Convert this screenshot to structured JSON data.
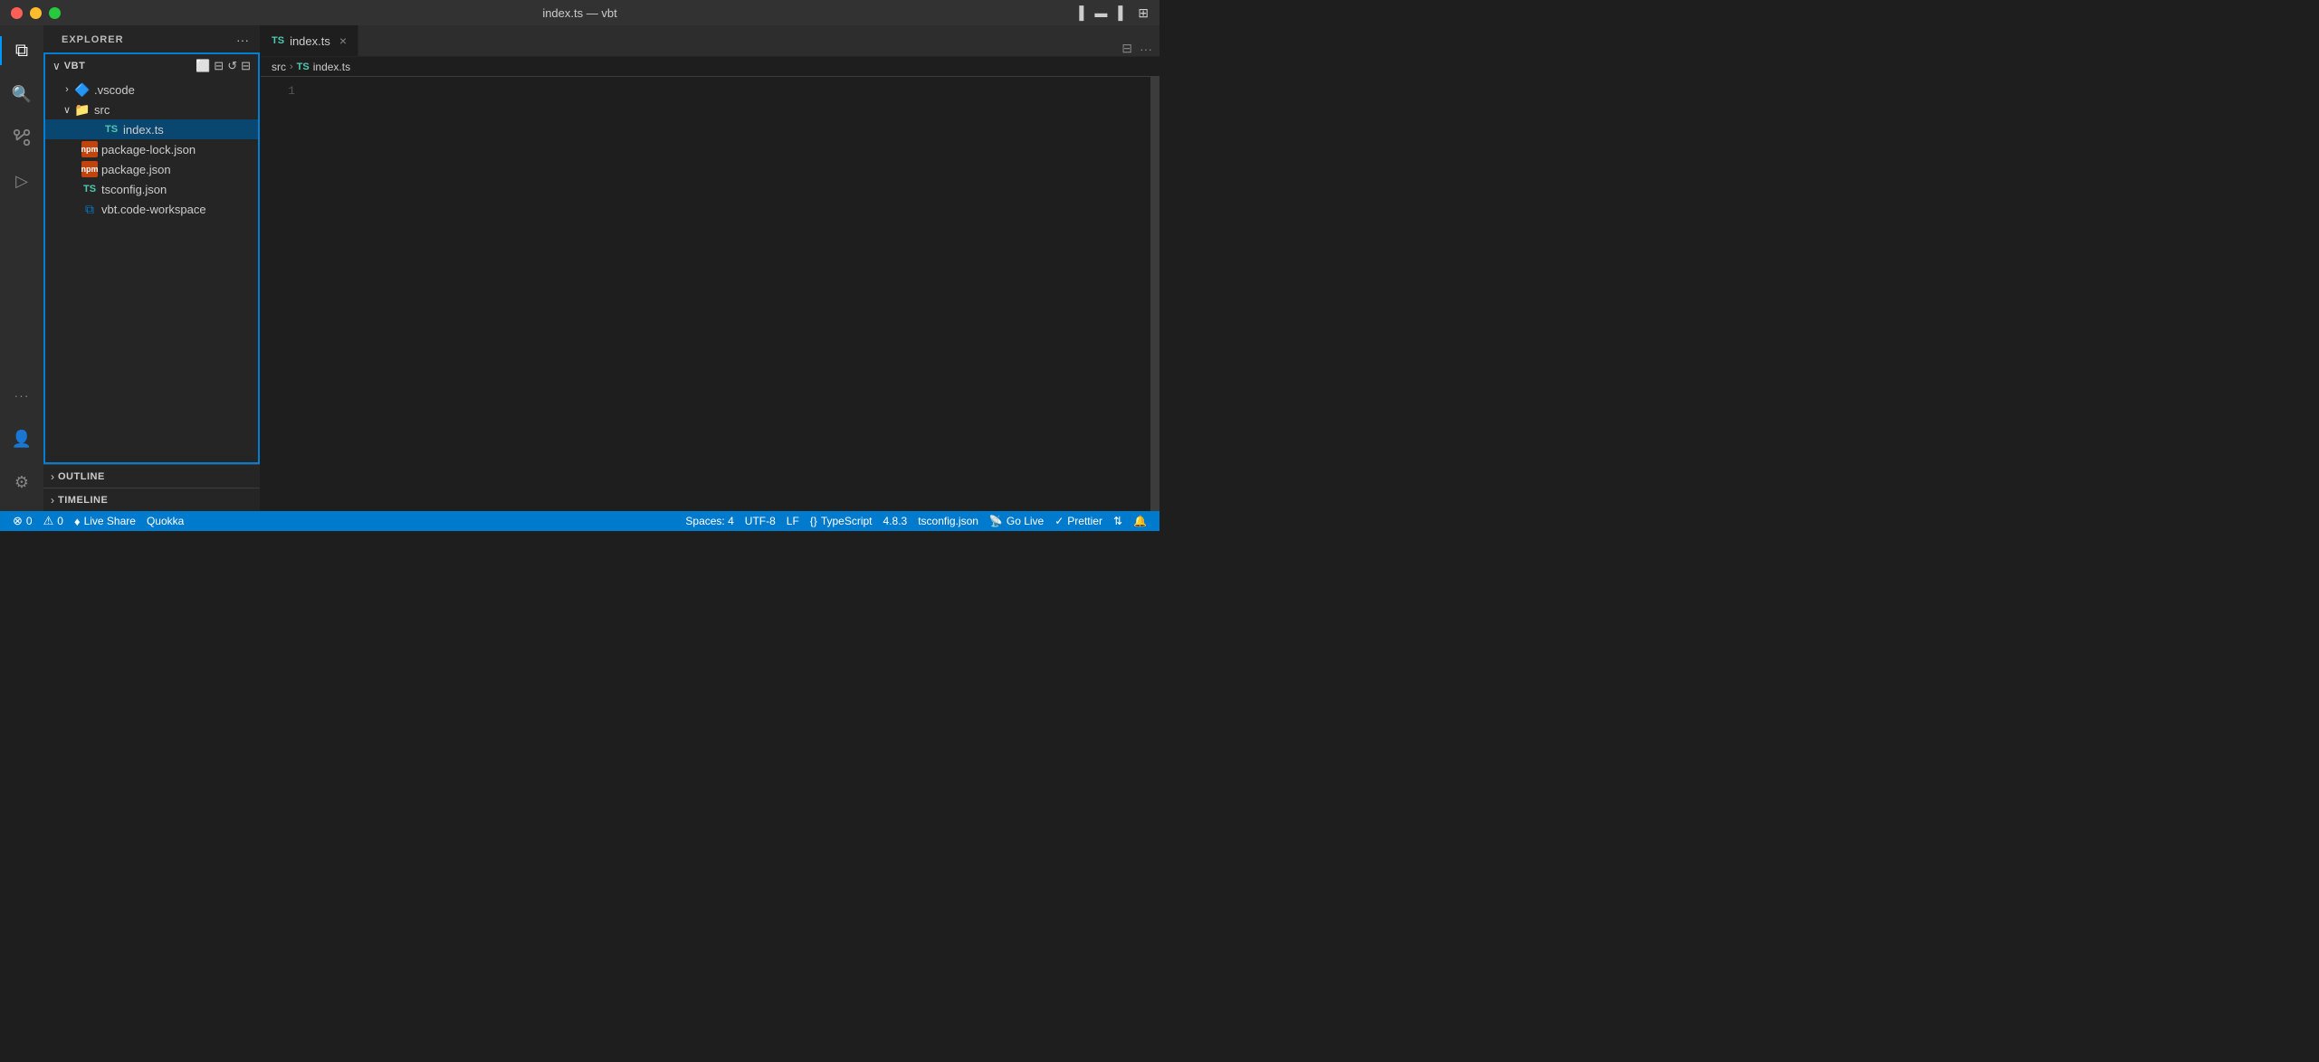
{
  "titlebar": {
    "title": "index.ts — vbt",
    "buttons": {
      "close": "close",
      "minimize": "minimize",
      "maximize": "maximize"
    },
    "right_icons": [
      "panel-left",
      "panel-bottom",
      "panel-right",
      "layout"
    ]
  },
  "activity_bar": {
    "items": [
      {
        "name": "explorer",
        "icon": "⧉",
        "active": true
      },
      {
        "name": "search",
        "icon": "🔍",
        "active": false
      },
      {
        "name": "source-control",
        "icon": "⎇",
        "active": false
      },
      {
        "name": "run-debug",
        "icon": "▷",
        "active": false
      },
      {
        "name": "more",
        "icon": "···",
        "active": false
      }
    ],
    "bottom_items": [
      {
        "name": "account",
        "icon": "👤"
      },
      {
        "name": "settings",
        "icon": "⚙"
      }
    ]
  },
  "sidebar": {
    "title": "EXPLORER",
    "more_icon": "···",
    "project": {
      "name": "VBT",
      "expanded": true
    },
    "toolbar": {
      "new_file": "new-file",
      "new_folder": "new-folder",
      "refresh": "refresh",
      "collapse": "collapse"
    },
    "tree": [
      {
        "type": "folder",
        "name": ".vscode",
        "level": 1,
        "expanded": false,
        "icon_color": "#007acc"
      },
      {
        "type": "folder",
        "name": "src",
        "level": 1,
        "expanded": true,
        "icon_color": "#4db6ac"
      },
      {
        "type": "file",
        "name": "index.ts",
        "level": 2,
        "icon": "TS",
        "icon_color": "#4ec9b0",
        "selected": true
      },
      {
        "type": "file",
        "name": "package-lock.json",
        "level": 1,
        "icon": "json",
        "icon_color": "#e2a644"
      },
      {
        "type": "file",
        "name": "package.json",
        "level": 1,
        "icon": "json",
        "icon_color": "#e2a644"
      },
      {
        "type": "file",
        "name": "tsconfig.json",
        "level": 1,
        "icon": "tsconfig",
        "icon_color": "#4ec9b0"
      },
      {
        "type": "file",
        "name": "vbt.code-workspace",
        "level": 1,
        "icon": "vscode",
        "icon_color": "#007acc"
      }
    ],
    "outline": {
      "title": "OUTLINE"
    },
    "timeline": {
      "title": "TIMELINE"
    }
  },
  "editor": {
    "tabs": [
      {
        "label": "index.ts",
        "ts_icon": "TS",
        "active": true,
        "modified": false
      }
    ],
    "breadcrumb": [
      "src",
      "index.ts"
    ],
    "line_count": 1,
    "content": ""
  },
  "status_bar": {
    "left": [
      {
        "icon": "⊗",
        "text": "0",
        "name": "errors"
      },
      {
        "icon": "⚠",
        "text": "0",
        "name": "warnings"
      },
      {
        "icon": "♦",
        "text": "Live Share",
        "name": "live-share"
      },
      {
        "text": "Quokka",
        "name": "quokka"
      }
    ],
    "right": [
      {
        "text": "Spaces: 4",
        "name": "spaces"
      },
      {
        "text": "UTF-8",
        "name": "encoding"
      },
      {
        "text": "LF",
        "name": "line-endings"
      },
      {
        "icon": "{}",
        "text": "TypeScript",
        "name": "language"
      },
      {
        "text": "4.8.3",
        "name": "ts-version"
      },
      {
        "text": "tsconfig.json",
        "name": "tsconfig"
      },
      {
        "icon": "📡",
        "text": "Go Live",
        "name": "go-live"
      },
      {
        "icon": "✓",
        "text": "Prettier",
        "name": "prettier"
      },
      {
        "icon": "⇅",
        "text": "",
        "name": "sync"
      },
      {
        "icon": "🔔",
        "text": "",
        "name": "notifications"
      }
    ]
  }
}
